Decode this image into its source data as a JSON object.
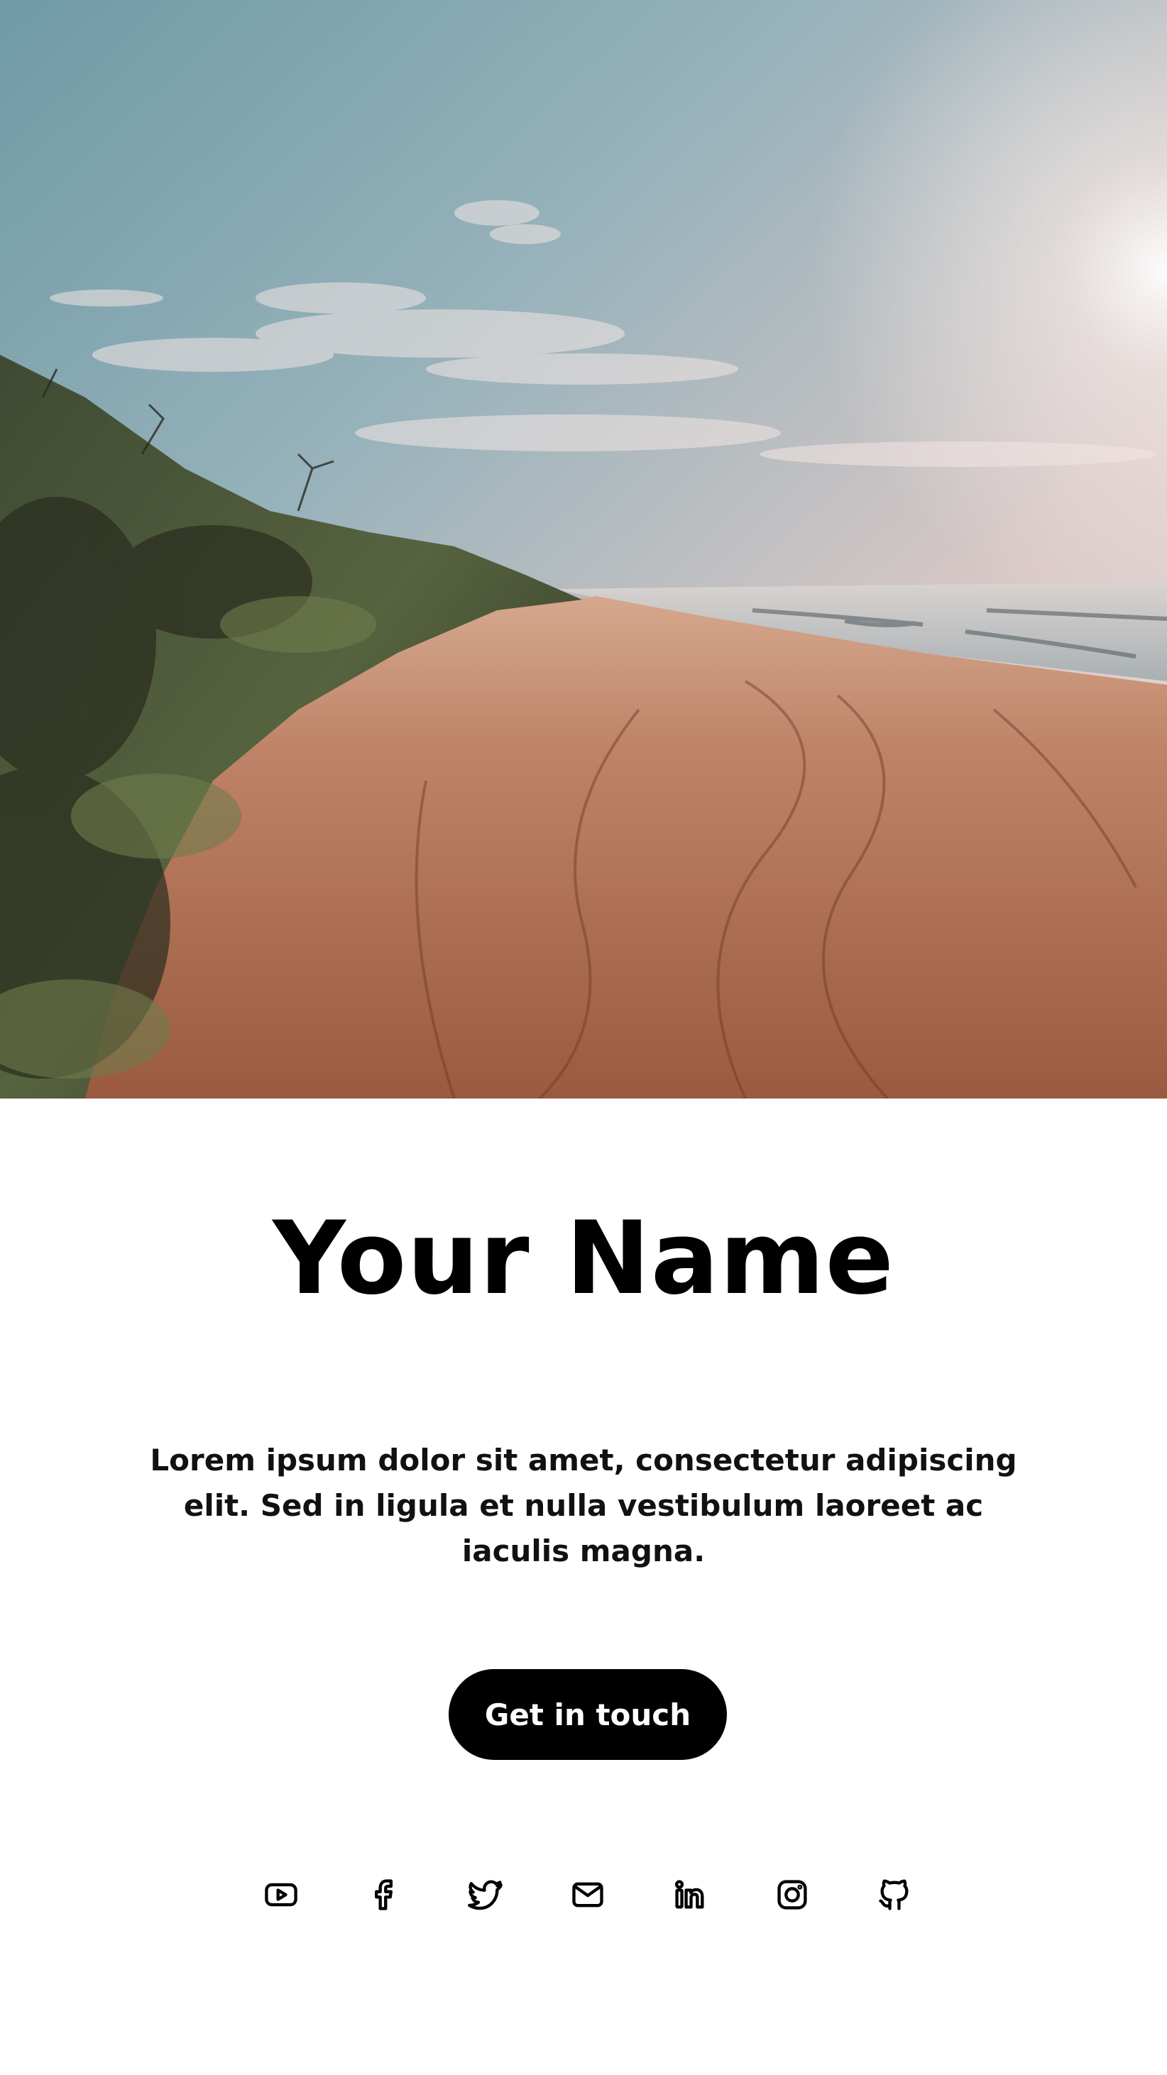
{
  "profile": {
    "name": "Your Name",
    "bio": "Lorem ipsum dolor sit amet, consectetur adipiscing elit. Sed in ligula et nulla vestibulum laoreet ac iaculis magna.",
    "cta_label": "Get in touch"
  },
  "hero": {
    "description": "beach-landscape-photo"
  },
  "socials": [
    {
      "name": "youtube",
      "icon": "youtube-icon"
    },
    {
      "name": "facebook",
      "icon": "facebook-icon"
    },
    {
      "name": "twitter",
      "icon": "twitter-icon"
    },
    {
      "name": "email",
      "icon": "mail-icon"
    },
    {
      "name": "linkedin",
      "icon": "linkedin-icon"
    },
    {
      "name": "instagram",
      "icon": "instagram-icon"
    },
    {
      "name": "github",
      "icon": "github-icon"
    }
  ],
  "colors": {
    "button_bg": "#000000",
    "button_text": "#ffffff",
    "page_bg": "#ffffff"
  }
}
